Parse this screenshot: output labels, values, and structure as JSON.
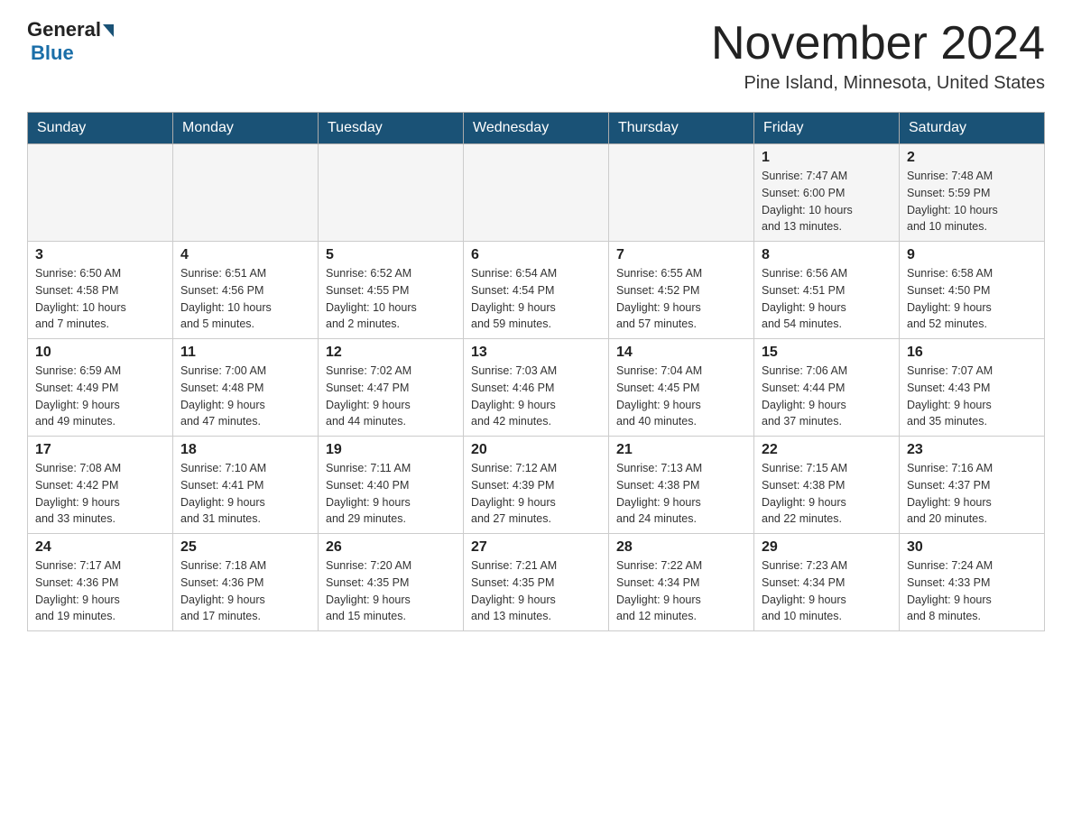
{
  "header": {
    "logo_general": "General",
    "logo_blue": "Blue",
    "month_title": "November 2024",
    "location": "Pine Island, Minnesota, United States"
  },
  "weekdays": [
    "Sunday",
    "Monday",
    "Tuesday",
    "Wednesday",
    "Thursday",
    "Friday",
    "Saturday"
  ],
  "weeks": [
    [
      {
        "day": "",
        "info": ""
      },
      {
        "day": "",
        "info": ""
      },
      {
        "day": "",
        "info": ""
      },
      {
        "day": "",
        "info": ""
      },
      {
        "day": "",
        "info": ""
      },
      {
        "day": "1",
        "info": "Sunrise: 7:47 AM\nSunset: 6:00 PM\nDaylight: 10 hours\nand 13 minutes."
      },
      {
        "day": "2",
        "info": "Sunrise: 7:48 AM\nSunset: 5:59 PM\nDaylight: 10 hours\nand 10 minutes."
      }
    ],
    [
      {
        "day": "3",
        "info": "Sunrise: 6:50 AM\nSunset: 4:58 PM\nDaylight: 10 hours\nand 7 minutes."
      },
      {
        "day": "4",
        "info": "Sunrise: 6:51 AM\nSunset: 4:56 PM\nDaylight: 10 hours\nand 5 minutes."
      },
      {
        "day": "5",
        "info": "Sunrise: 6:52 AM\nSunset: 4:55 PM\nDaylight: 10 hours\nand 2 minutes."
      },
      {
        "day": "6",
        "info": "Sunrise: 6:54 AM\nSunset: 4:54 PM\nDaylight: 9 hours\nand 59 minutes."
      },
      {
        "day": "7",
        "info": "Sunrise: 6:55 AM\nSunset: 4:52 PM\nDaylight: 9 hours\nand 57 minutes."
      },
      {
        "day": "8",
        "info": "Sunrise: 6:56 AM\nSunset: 4:51 PM\nDaylight: 9 hours\nand 54 minutes."
      },
      {
        "day": "9",
        "info": "Sunrise: 6:58 AM\nSunset: 4:50 PM\nDaylight: 9 hours\nand 52 minutes."
      }
    ],
    [
      {
        "day": "10",
        "info": "Sunrise: 6:59 AM\nSunset: 4:49 PM\nDaylight: 9 hours\nand 49 minutes."
      },
      {
        "day": "11",
        "info": "Sunrise: 7:00 AM\nSunset: 4:48 PM\nDaylight: 9 hours\nand 47 minutes."
      },
      {
        "day": "12",
        "info": "Sunrise: 7:02 AM\nSunset: 4:47 PM\nDaylight: 9 hours\nand 44 minutes."
      },
      {
        "day": "13",
        "info": "Sunrise: 7:03 AM\nSunset: 4:46 PM\nDaylight: 9 hours\nand 42 minutes."
      },
      {
        "day": "14",
        "info": "Sunrise: 7:04 AM\nSunset: 4:45 PM\nDaylight: 9 hours\nand 40 minutes."
      },
      {
        "day": "15",
        "info": "Sunrise: 7:06 AM\nSunset: 4:44 PM\nDaylight: 9 hours\nand 37 minutes."
      },
      {
        "day": "16",
        "info": "Sunrise: 7:07 AM\nSunset: 4:43 PM\nDaylight: 9 hours\nand 35 minutes."
      }
    ],
    [
      {
        "day": "17",
        "info": "Sunrise: 7:08 AM\nSunset: 4:42 PM\nDaylight: 9 hours\nand 33 minutes."
      },
      {
        "day": "18",
        "info": "Sunrise: 7:10 AM\nSunset: 4:41 PM\nDaylight: 9 hours\nand 31 minutes."
      },
      {
        "day": "19",
        "info": "Sunrise: 7:11 AM\nSunset: 4:40 PM\nDaylight: 9 hours\nand 29 minutes."
      },
      {
        "day": "20",
        "info": "Sunrise: 7:12 AM\nSunset: 4:39 PM\nDaylight: 9 hours\nand 27 minutes."
      },
      {
        "day": "21",
        "info": "Sunrise: 7:13 AM\nSunset: 4:38 PM\nDaylight: 9 hours\nand 24 minutes."
      },
      {
        "day": "22",
        "info": "Sunrise: 7:15 AM\nSunset: 4:38 PM\nDaylight: 9 hours\nand 22 minutes."
      },
      {
        "day": "23",
        "info": "Sunrise: 7:16 AM\nSunset: 4:37 PM\nDaylight: 9 hours\nand 20 minutes."
      }
    ],
    [
      {
        "day": "24",
        "info": "Sunrise: 7:17 AM\nSunset: 4:36 PM\nDaylight: 9 hours\nand 19 minutes."
      },
      {
        "day": "25",
        "info": "Sunrise: 7:18 AM\nSunset: 4:36 PM\nDaylight: 9 hours\nand 17 minutes."
      },
      {
        "day": "26",
        "info": "Sunrise: 7:20 AM\nSunset: 4:35 PM\nDaylight: 9 hours\nand 15 minutes."
      },
      {
        "day": "27",
        "info": "Sunrise: 7:21 AM\nSunset: 4:35 PM\nDaylight: 9 hours\nand 13 minutes."
      },
      {
        "day": "28",
        "info": "Sunrise: 7:22 AM\nSunset: 4:34 PM\nDaylight: 9 hours\nand 12 minutes."
      },
      {
        "day": "29",
        "info": "Sunrise: 7:23 AM\nSunset: 4:34 PM\nDaylight: 9 hours\nand 10 minutes."
      },
      {
        "day": "30",
        "info": "Sunrise: 7:24 AM\nSunset: 4:33 PM\nDaylight: 9 hours\nand 8 minutes."
      }
    ]
  ]
}
